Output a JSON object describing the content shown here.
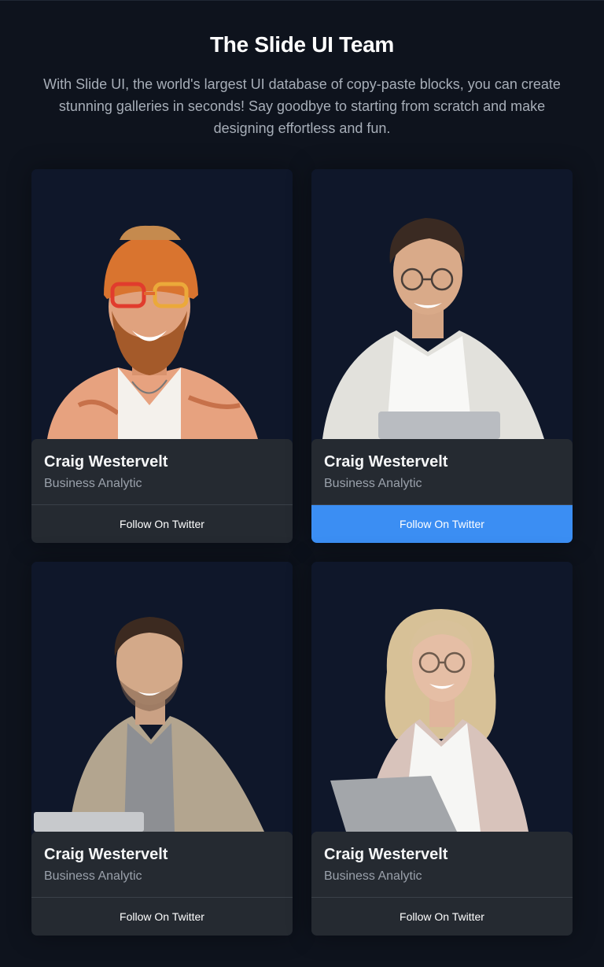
{
  "header": {
    "title": "The Slide UI Team",
    "subtitle": "With Slide UI, the world's largest UI database of copy-paste blocks, you can create stunning galleries in seconds! Say goodbye to starting from scratch and make designing effortless and fun."
  },
  "team": [
    {
      "name": "Craig Westervelt",
      "role": "Business Analytic",
      "button": "Follow On Twitter",
      "active": false
    },
    {
      "name": "Craig Westervelt",
      "role": "Business Analytic",
      "button": "Follow On Twitter",
      "active": true
    },
    {
      "name": "Craig Westervelt",
      "role": "Business Analytic",
      "button": "Follow On Twitter",
      "active": false
    },
    {
      "name": "Craig Westervelt",
      "role": "Business Analytic",
      "button": "Follow On Twitter",
      "active": false
    }
  ],
  "colors": {
    "background": "#0e131d",
    "card_photo_bg": "#0f172a",
    "card_info_bg": "#252a31",
    "accent": "#3b8ef3"
  }
}
